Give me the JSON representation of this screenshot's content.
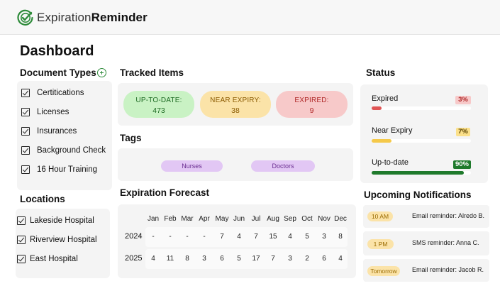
{
  "app": {
    "name_light": "Expiration",
    "name_bold": "Reminder",
    "logo_icon": "check-circle-icon",
    "accent": "#2e8b3a"
  },
  "page": {
    "title": "Dashboard"
  },
  "document_types": {
    "title": "Document Types",
    "add_icon": "plus-circle-icon",
    "items": [
      {
        "label": "Certitications",
        "checked": true
      },
      {
        "label": "Licenses",
        "checked": true
      },
      {
        "label": "Insurances",
        "checked": true
      },
      {
        "label": "Background Check",
        "checked": true
      },
      {
        "label": "16 Hour Training",
        "checked": true
      }
    ]
  },
  "locations": {
    "title": "Locations",
    "items": [
      {
        "label": "Lakeside Hospital",
        "checked": true
      },
      {
        "label": "Riverview Hospital",
        "checked": true
      },
      {
        "label": "East Hospital",
        "checked": true
      }
    ]
  },
  "tracked_items": {
    "title": "Tracked Items",
    "cards": [
      {
        "label": "UP-TO-DATE:",
        "value": "473",
        "bg": "#c9f2c4",
        "color": "#1e6b24"
      },
      {
        "label": "NEAR EXPIRY:",
        "value": "38",
        "bg": "#fbe3a8",
        "color": "#8a5a00"
      },
      {
        "label": "EXPIRED:",
        "value": "9",
        "bg": "#f7c9c9",
        "color": "#b02a2a"
      }
    ]
  },
  "tags": {
    "title": "Tags",
    "items": [
      {
        "label": "Nurses"
      },
      {
        "label": "Doctors"
      }
    ]
  },
  "forecast": {
    "title": "Expiration Forecast",
    "months": [
      "Jan",
      "Feb",
      "Mar",
      "Apr",
      "May",
      "Jun",
      "Jul",
      "Aug",
      "Sep",
      "Oct",
      "Nov",
      "Dec"
    ],
    "rows": [
      {
        "year": "2024",
        "values": [
          "-",
          "-",
          "-",
          "-",
          "7",
          "4",
          "7",
          "15",
          "4",
          "5",
          "3",
          "8"
        ]
      },
      {
        "year": "2025",
        "values": [
          "4",
          "11",
          "8",
          "3",
          "6",
          "5",
          "17",
          "7",
          "3",
          "2",
          "6",
          "4"
        ]
      }
    ]
  },
  "status": {
    "title": "Status",
    "items": [
      {
        "label": "Expired",
        "percent": "3%",
        "fraction": 0.1,
        "badge_bg": "#f7c9c9",
        "badge_color": "#b02a2a",
        "fill": "#e05555"
      },
      {
        "label": "Near Expiry",
        "percent": "7%",
        "fraction": 0.2,
        "badge_bg": "#fbe08a",
        "badge_color": "#5a4200",
        "fill": "#f5c94a"
      },
      {
        "label": "Up-to-date",
        "percent": "90%",
        "fraction": 0.93,
        "badge_bg": "#1f7a2c",
        "badge_color": "#ffffff",
        "fill": "#1f7a2c"
      }
    ]
  },
  "notifications": {
    "title": "Upcoming Notifications",
    "items": [
      {
        "time": "10 AM",
        "text": "Email reminder: Alredo B."
      },
      {
        "time": "1 PM",
        "text": "SMS reminder: Anna C."
      },
      {
        "time": "Tomorrow",
        "text": "Email reminder: Jacob R."
      }
    ]
  }
}
